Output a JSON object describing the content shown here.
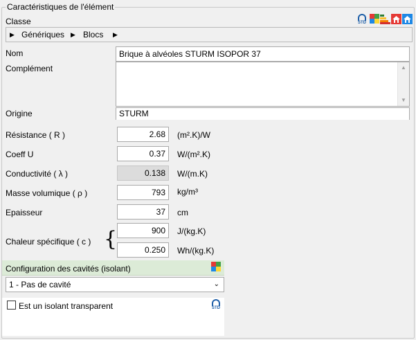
{
  "group_title": "Caractéristiques de l'élément",
  "classe": {
    "label": "Classe",
    "breadcrumb": [
      "Génériques",
      "Blocs"
    ]
  },
  "nom": {
    "label": "Nom",
    "value": "Brique à alvéoles STURM ISOPOR 37"
  },
  "complement": {
    "label": "Complément",
    "value": ""
  },
  "origine": {
    "label": "Origine",
    "value": "STURM"
  },
  "resistance": {
    "label": "Résistance ( R )",
    "value": "2.68",
    "unit": "(m².K)/W"
  },
  "coeff_u": {
    "label": "Coeff U",
    "value": "0.37",
    "unit": "W/(m².K)"
  },
  "conductivite": {
    "label": "Conductivité ( λ )",
    "value": "0.138",
    "unit": "W/(m.K)"
  },
  "masse": {
    "label": "Masse volumique ( ρ )",
    "value": "793",
    "unit": "kg/m³"
  },
  "epaisseur": {
    "label": "Epaisseur",
    "value": "37",
    "unit": "cm"
  },
  "chaleur": {
    "label": "Chaleur spécifique ( c )",
    "brace": "{",
    "value1": "900",
    "unit1": "J/(kg.K)",
    "value2": "0.250",
    "unit2": "Wh/(kg.K)"
  },
  "cavites": {
    "title": "Configuration des cavités (isolant)",
    "selected": "1 - Pas de cavité"
  },
  "isolant_transparent": {
    "label": "Est un isolant transparent",
    "checked": false
  },
  "std_text": "STD",
  "icons": {
    "std": "std-logo-icon",
    "mosaic": "color-mosaic-icon",
    "chart": "energy-bars-icon",
    "house_red": "house-red-icon",
    "house_blue": "house-blue-icon",
    "brace": "curly-brace"
  },
  "colors": {
    "header_green": "#dcebd7",
    "readonly_bg": "#dcdcdc",
    "std_blue": "#1e5fa8"
  }
}
